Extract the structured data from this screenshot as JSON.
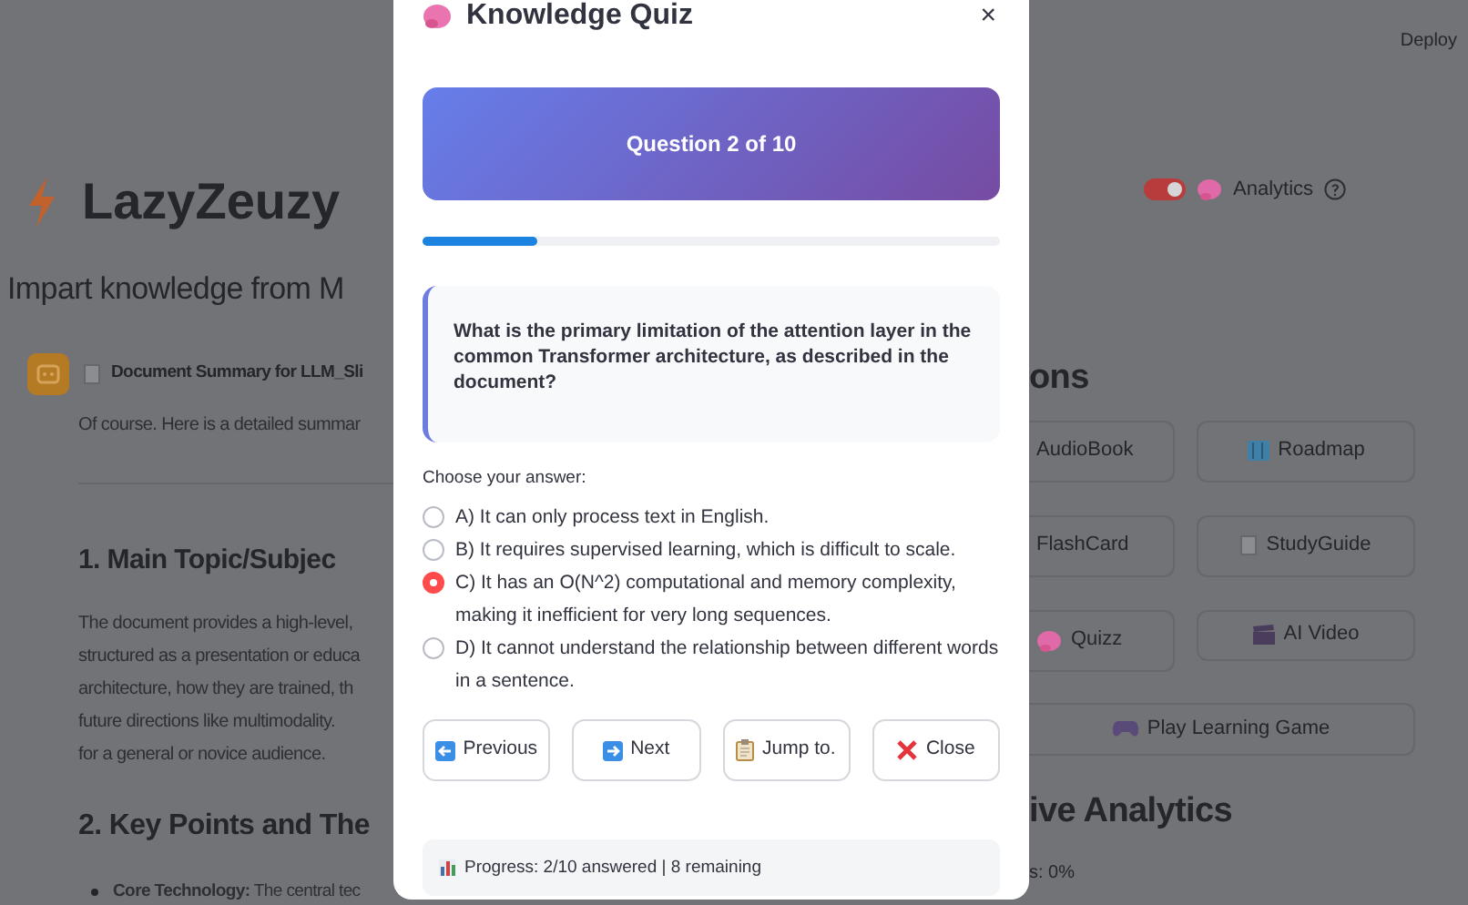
{
  "app": {
    "deploy": "Deploy",
    "title": "LazyZeuzy",
    "subtitle": "Impart knowledge from M",
    "analytics_toggle": {
      "on": true,
      "label": "Analytics"
    }
  },
  "chat": {
    "heading": "Document Summary for LLM_Sli",
    "intro": "Of course. Here is a detailed summar",
    "section_1": "1. Main Topic/Subjec",
    "paragraph_lines": [
      "The document provides a high-level,",
      "structured as a presentation or educa",
      "architecture, how they are trained, th",
      "future directions like multimodality. ",
      "for a general or novice audience."
    ],
    "section_2": "2. Key Points and The",
    "bullet": "**Core Technology:** The central tec"
  },
  "actions": {
    "heading": "ons",
    "buttons": [
      {
        "label": "AudioBook"
      },
      {
        "label": "Roadmap"
      },
      {
        "label": "FlashCard"
      },
      {
        "label": "StudyGuide"
      },
      {
        "label": "Quizz"
      },
      {
        "label": "AI Video"
      },
      {
        "label": "Play Learning Game"
      }
    ]
  },
  "analytics": {
    "heading": "ive Analytics",
    "line": "s: 0%"
  },
  "quiz": {
    "title": "Knowledge Quiz",
    "close": "×",
    "header": "Question 2 of 10",
    "progress": {
      "level": 0.2
    },
    "question": "What is the primary limitation of the attention layer in the common Transformer architecture, as described in the document?",
    "prompt": "Choose your answer:",
    "options": [
      {
        "label": "A) It can only process text in English.",
        "selected": false
      },
      {
        "label": "B) It requires supervised learning, which is difficult to scale.",
        "selected": false
      },
      {
        "label": "C) It has an O(N^2) computational and memory complexity, making it inefficient for very long sequences.",
        "selected": true
      },
      {
        "label": "D) It cannot understand the relationship between different words in a sentence.",
        "selected": false
      }
    ],
    "buttons": [
      {
        "label": "Previous"
      },
      {
        "label": "Next"
      },
      {
        "label": "Jump to."
      },
      {
        "label": "Close"
      }
    ],
    "status": "Progress: 2/10 answered | 8 remaining"
  }
}
